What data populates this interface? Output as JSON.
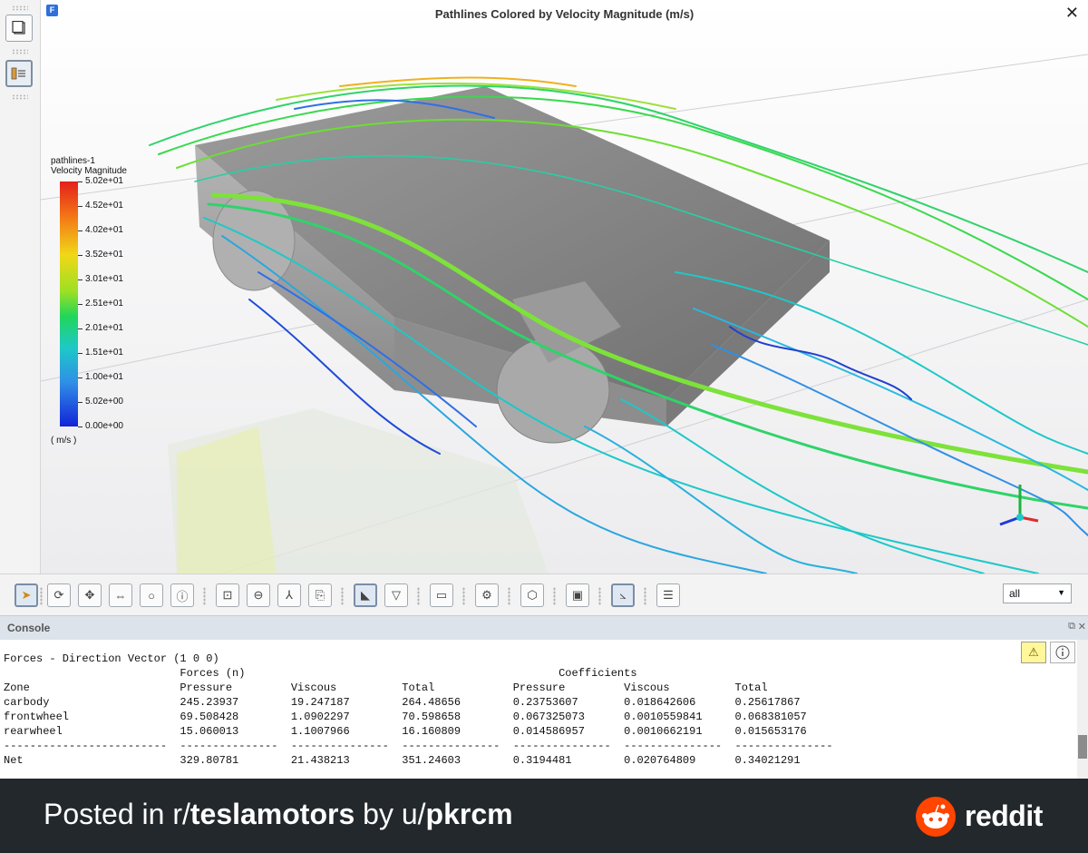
{
  "window": {
    "title": "Pathlines Colored by Velocity Magnitude (m/s)",
    "close_glyph": "✕",
    "app_logo": "F"
  },
  "legend": {
    "name": "pathlines-1",
    "quantity": "Velocity Magnitude",
    "unit": "( m/s )",
    "ticks": [
      "5.02e+01",
      "4.52e+01",
      "4.02e+01",
      "3.52e+01",
      "3.01e+01",
      "2.51e+01",
      "2.01e+01",
      "1.51e+01",
      "1.00e+01",
      "5.02e+00",
      "0.00e+00"
    ],
    "colors": [
      "#e3201a",
      "#f47b16",
      "#f0d818",
      "#9be024",
      "#21d65a",
      "#1ec8c8",
      "#2f8fe6",
      "#1323d8"
    ]
  },
  "toolbar": {
    "icons": [
      "select-arrow-icon",
      "rotate-icon",
      "pan-icon",
      "zoom-in-out-icon",
      "zoom-icon",
      "probe-info-icon",
      "zoom-fit-icon",
      "zoom-to-area-icon",
      "axes-orient-icon",
      "view-save-icon",
      "lighting-icon",
      "shading-icon",
      "ruler-icon",
      "camera-settings-icon",
      "isometric-view-icon",
      "view-layout-icon",
      "axes-toggle-icon",
      "notes-icon"
    ],
    "selection_filter": "all"
  },
  "console": {
    "title": "Console",
    "lines": [
      "Forces - Direction Vector (1 0 0)",
      "                           Forces (n)                                                Coefficients",
      "Zone                       Pressure         Viscous          Total            Pressure         Viscous          Total",
      "carbody                    245.23937        19.247187        264.48656        0.23753607       0.018642606      0.25617867",
      "frontwheel                 69.508428        1.0902297        70.598658        0.067325073      0.0010559841     0.068381057",
      "rearwheel                  15.060013        1.1007966        16.160809        0.014586957      0.0010662191     0.015653176",
      "-------------------------  ---------------  ---------------  ---------------  ---------------  ---------------  ---------------",
      "Net                        329.80781        21.438213        351.24603        0.3194481        0.020764809      0.34021291"
    ]
  },
  "footer": {
    "prefix": "Posted in r/",
    "subreddit": "teslamotors",
    "middle": " by u/",
    "user": "pkrcm",
    "brand": "reddit"
  }
}
